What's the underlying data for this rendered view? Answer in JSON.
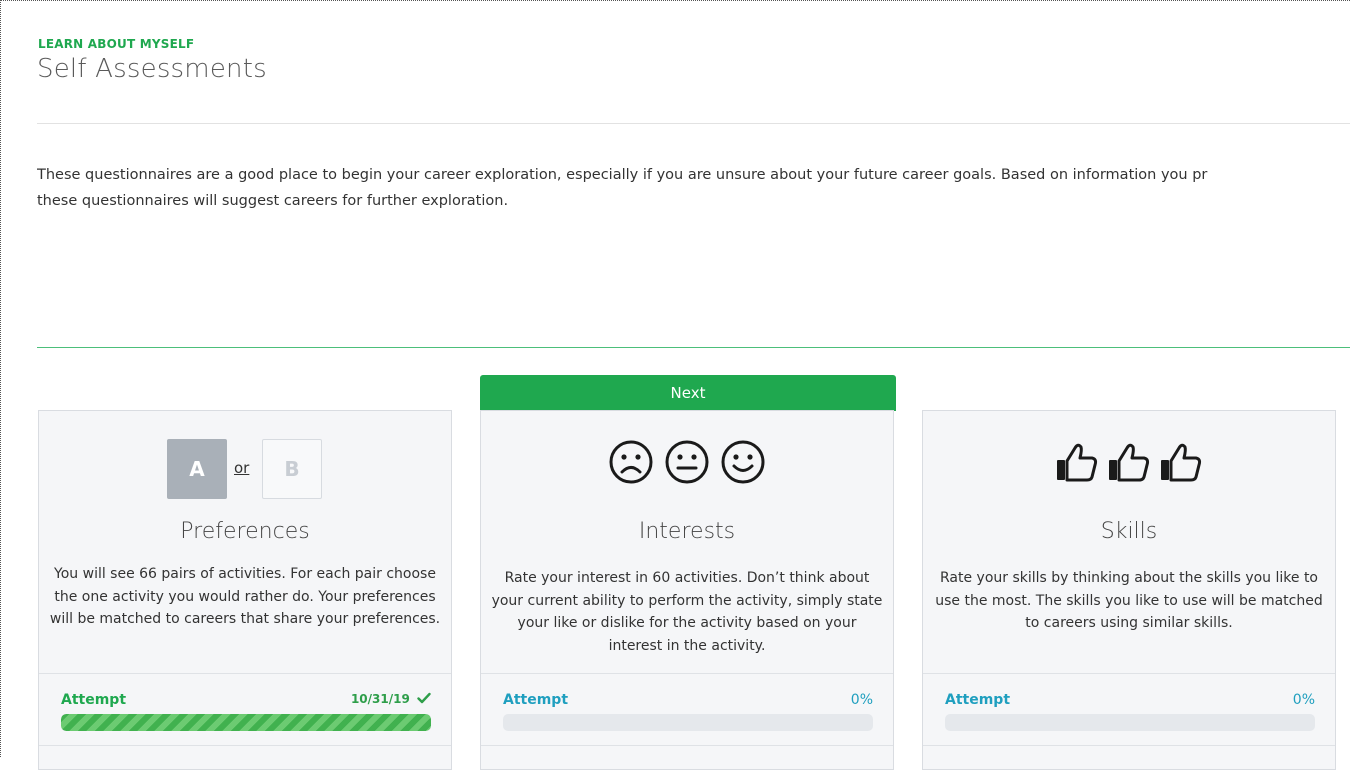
{
  "header": {
    "eyebrow": "LEARN ABOUT MYSELF",
    "title": "Self Assessments"
  },
  "intro": {
    "line1": "These questionnaires are a good place to begin your career exploration, especially if you are unsure about your future career goals. Based on information you pr",
    "line2": "these questionnaires will suggest careers for further exploration."
  },
  "colors": {
    "brand_green": "#1fa84f",
    "accent_teal": "#1f9fbf",
    "divider_green": "#4cbf7a"
  },
  "cards": [
    {
      "title": "Preferences",
      "icon": "a-or-b-icon",
      "icon_a": "A",
      "icon_or": "or",
      "icon_b": "B",
      "desc": "You will see 66 pairs of activities. For each pair choose the one activity you would rather do. Your preferences will be matched to careers that share your preferences.",
      "attempt_label": "Attempt",
      "status": "10/31/19",
      "progress": 1.0
    },
    {
      "banner": "Next",
      "title": "Interests",
      "icon": "faces-icon",
      "desc": "Rate your interest in 60 activities. Don’t think about your current ability to perform the activity, simply state your like or dislike for the activity based on your interest in the activity.",
      "attempt_label": "Attempt",
      "status": "0%",
      "progress": 0.0
    },
    {
      "title": "Skills",
      "icon": "thumbs-up-icon",
      "desc": "Rate your skills by thinking about the skills you like to use the most. The skills you like to use will be matched to careers using similar skills.",
      "attempt_label": "Attempt",
      "status": "0%",
      "progress": 0.0
    }
  ]
}
